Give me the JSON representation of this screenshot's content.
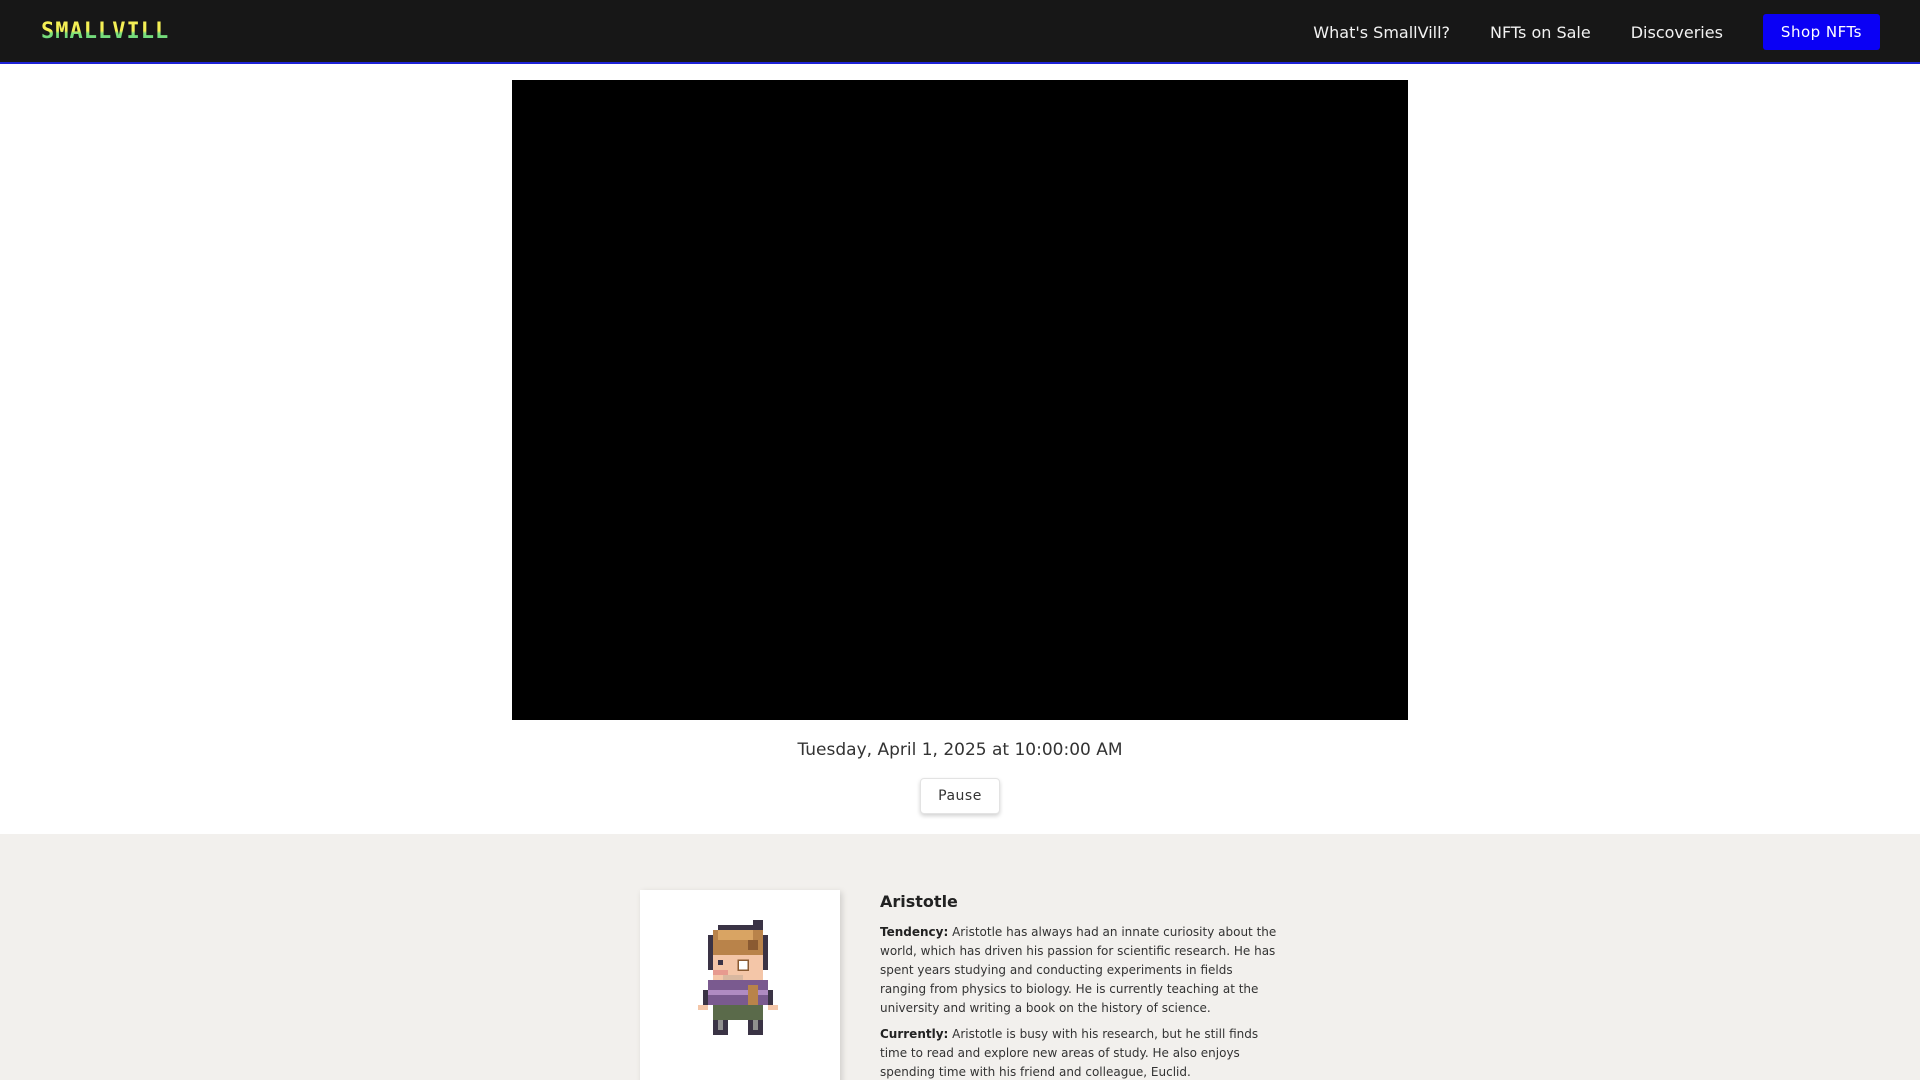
{
  "header": {
    "logo": "SMALLVILL",
    "nav": [
      "What's SmallVill?",
      "NFTs on Sale",
      "Discoveries"
    ],
    "cta": "Shop NFTs"
  },
  "game": {
    "timestamp": "Tuesday, April 1, 2025 at 10:00:00 AM",
    "pause_label": "Pause"
  },
  "persona": {
    "name": "Aristotle",
    "tendency_label": "Tendency:",
    "tendency_text": " Aristotle has always had an innate curiosity about the world, which has driven his passion for scientific research. He has spent years studying and conducting experiments in fields ranging from physics to biology. He is currently teaching at the university and writing a book on the history of science.",
    "currently_label": "Currently:",
    "currently_text": " Aristotle is busy with his research, but he still finds time to read and explore new areas of study. He also enjoys spending time with his friend and colleague, Euclid."
  },
  "colors": {
    "nav_bg": "#171717",
    "accent": "#0a00f5",
    "section_bg": "#f2f0ed"
  }
}
